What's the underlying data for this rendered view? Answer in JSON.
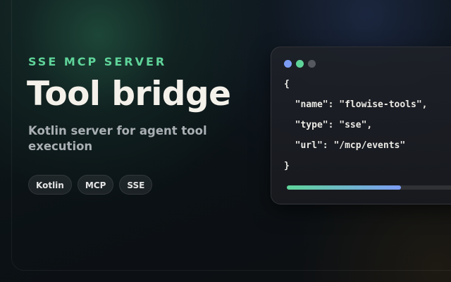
{
  "hero": {
    "eyebrow": "SSE MCP SERVER",
    "title": "Tool bridge",
    "subtitle": "Kotlin server for agent tool execution",
    "tags": [
      "Kotlin",
      "MCP",
      "SSE"
    ]
  },
  "code_panel": {
    "window_dots": [
      "blue",
      "green",
      "gray"
    ],
    "lines": [
      "{",
      "  \"name\": \"flowise-tools\",",
      "  \"type\": \"sse\",",
      "  \"url\": \"/mcp/events\"",
      "}"
    ],
    "progress_fraction": 0.6
  },
  "colors": {
    "accent_green": "#5fd49a",
    "accent_blue": "#7c9cf4",
    "title_text": "#f4f1ea",
    "subtitle_text": "#a9afb4"
  }
}
